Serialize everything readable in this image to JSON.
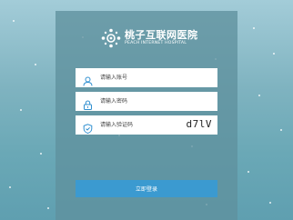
{
  "brand": {
    "name_cn": "桃子互联网医院",
    "name_en": "PEACH INTERNET HOSPITAL",
    "logo_icon": "peach-hospital-logo-icon"
  },
  "form": {
    "account": {
      "placeholder": "请输入账号",
      "value": "",
      "icon": "user-icon"
    },
    "password": {
      "placeholder": "请输入密码",
      "value": "",
      "icon": "lock-icon"
    },
    "captcha": {
      "placeholder": "请输入验证码",
      "value": "",
      "icon": "shield-check-icon",
      "code": "d7lV"
    },
    "submit_label": "立即登录"
  },
  "colors": {
    "accent": "#3b9ad0",
    "icon": "#2f8fd0",
    "panel": "#5f919e"
  }
}
